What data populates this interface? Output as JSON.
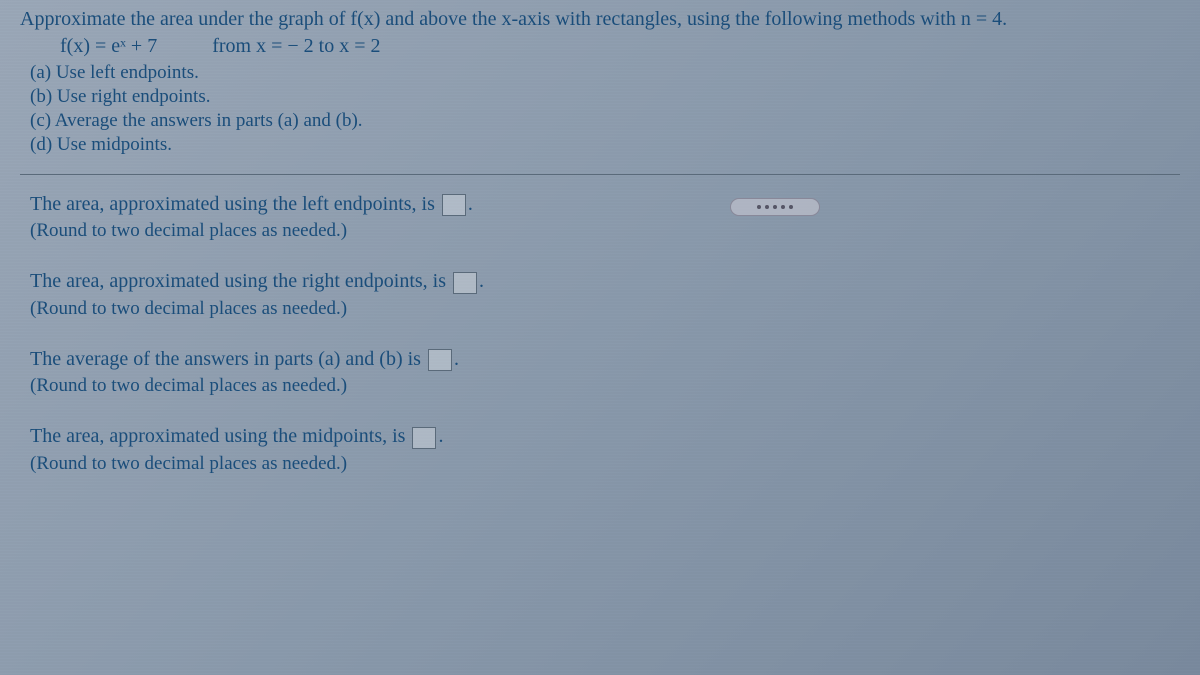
{
  "problem": {
    "statement": "Approximate the area under the graph of f(x) and above the x-axis with rectangles, using the following methods with n = 4.",
    "function": "f(x) = eˣ + 7",
    "interval": "from x = − 2 to x = 2"
  },
  "options": {
    "a": "(a) Use left endpoints.",
    "b": "(b) Use right endpoints.",
    "c": "(c) Average the answers in parts (a) and (b).",
    "d": "(d) Use midpoints."
  },
  "answers": {
    "left": {
      "text_before": "The area, approximated using the left endpoints, is ",
      "text_after": ".",
      "round": "(Round to two decimal places as needed.)"
    },
    "right": {
      "text_before": "The area, approximated using the right endpoints, is ",
      "text_after": ".",
      "round": "(Round to two decimal places as needed.)"
    },
    "average": {
      "text_before": "The average of the answers in parts (a) and (b) is ",
      "text_after": ".",
      "round": "(Round to two decimal places as needed.)"
    },
    "midpoints": {
      "text_before": "The area, approximated using the midpoints, is ",
      "text_after": ".",
      "round": "(Round to two decimal places as needed.)"
    }
  }
}
